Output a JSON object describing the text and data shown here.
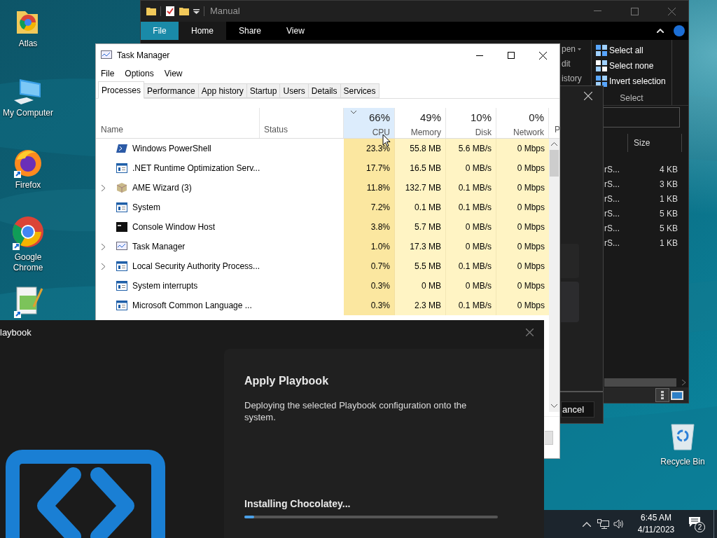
{
  "desktop": {
    "icons": [
      {
        "label": "Atlas"
      },
      {
        "label": "My Computer"
      },
      {
        "label": "Firefox"
      },
      {
        "label": "Google Chrome"
      }
    ],
    "recycle_bin": {
      "label": "Recycle Bin"
    }
  },
  "explorer": {
    "title": "Manual",
    "tabs": [
      {
        "label": "File",
        "kind": "menu",
        "selected": false
      },
      {
        "label": "Home",
        "kind": "tab",
        "selected": true
      },
      {
        "label": "Share",
        "kind": "tab",
        "selected": false
      },
      {
        "label": "View",
        "kind": "tab",
        "selected": false
      }
    ],
    "open_group": [
      "pen",
      "dit",
      "istory"
    ],
    "select_group": {
      "items": [
        "Select all",
        "Select none",
        "Invert selection"
      ],
      "label": "Select"
    },
    "columns": [
      "Size"
    ],
    "rows": [
      {
        "name": "rS...",
        "size": "4 KB"
      },
      {
        "name": "rS...",
        "size": "3 KB"
      },
      {
        "name": "rS...",
        "size": "1 KB"
      },
      {
        "name": "rS...",
        "size": "5 KB"
      },
      {
        "name": "rS...",
        "size": "5 KB"
      },
      {
        "name": "rS...",
        "size": "1 KB"
      }
    ]
  },
  "dialog": {
    "button": "ancel"
  },
  "task_manager": {
    "title": "Task Manager",
    "menu": [
      "File",
      "Options",
      "View"
    ],
    "tabs": [
      {
        "label": "Processes",
        "selected": true
      },
      {
        "label": "Performance",
        "selected": false
      },
      {
        "label": "App history",
        "selected": false
      },
      {
        "label": "Startup",
        "selected": false
      },
      {
        "label": "Users",
        "selected": false
      },
      {
        "label": "Details",
        "selected": false
      },
      {
        "label": "Services",
        "selected": false
      }
    ],
    "columns": [
      {
        "label": "Name"
      },
      {
        "label": "Status"
      },
      {
        "label": "CPU",
        "usage": "66%",
        "sorted": true
      },
      {
        "label": "Memory",
        "usage": "49%",
        "sorted": false
      },
      {
        "label": "Disk",
        "usage": "10%",
        "sorted": false
      },
      {
        "label": "Network",
        "usage": "0%",
        "sorted": false
      },
      {
        "label": "P"
      }
    ],
    "rows": [
      {
        "name": "Windows PowerShell",
        "expandable": false,
        "cpu": "23.3%",
        "memory": "55.8 MB",
        "disk": "5.6 MB/s",
        "network": "0 Mbps"
      },
      {
        "name": ".NET Runtime Optimization Serv...",
        "expandable": false,
        "cpu": "17.7%",
        "memory": "16.5 MB",
        "disk": "0 MB/s",
        "network": "0 Mbps"
      },
      {
        "name": "AME Wizard (3)",
        "expandable": true,
        "cpu": "11.8%",
        "memory": "132.7 MB",
        "disk": "0.1 MB/s",
        "network": "0 Mbps"
      },
      {
        "name": "System",
        "expandable": false,
        "cpu": "7.2%",
        "memory": "0.1 MB",
        "disk": "0.1 MB/s",
        "network": "0 Mbps"
      },
      {
        "name": "Console Window Host",
        "expandable": false,
        "cpu": "3.8%",
        "memory": "5.7 MB",
        "disk": "0 MB/s",
        "network": "0 Mbps"
      },
      {
        "name": "Task Manager",
        "expandable": true,
        "cpu": "1.0%",
        "memory": "17.3 MB",
        "disk": "0 MB/s",
        "network": "0 Mbps"
      },
      {
        "name": "Local Security Authority Process...",
        "expandable": true,
        "cpu": "0.7%",
        "memory": "5.5 MB",
        "disk": "0.1 MB/s",
        "network": "0 Mbps"
      },
      {
        "name": "System interrupts",
        "expandable": false,
        "cpu": "0.3%",
        "memory": "0 MB",
        "disk": "0 MB/s",
        "network": "0 Mbps"
      },
      {
        "name": "Microsoft Common Language ...",
        "expandable": false,
        "cpu": "0.3%",
        "memory": "2.3 MB",
        "disk": "0.1 MB/s",
        "network": "0 Mbps"
      }
    ]
  },
  "playbook": {
    "title": "laybook",
    "heading": "Apply Playbook",
    "description": "Deploying the selected Playbook configuration onto the system.",
    "status": "Installing Chocolatey...",
    "level": 0.04
  },
  "taskbar": {
    "time": "6:45 AM",
    "date": "4/11/2023",
    "notification_count": "2"
  }
}
